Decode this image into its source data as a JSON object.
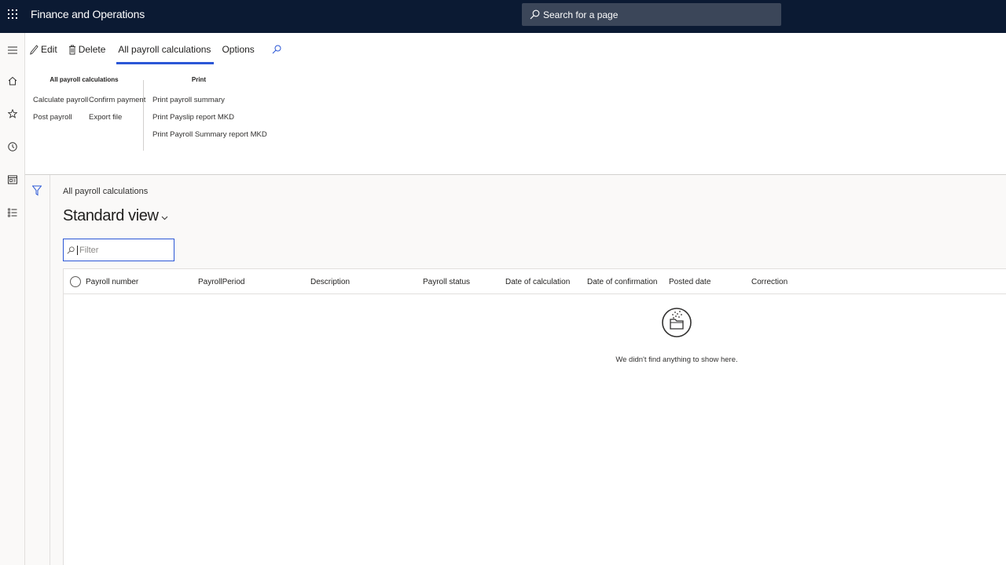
{
  "app": {
    "title": "Finance and Operations"
  },
  "search": {
    "placeholder": "Search for a page"
  },
  "nav": {
    "icons": [
      "hamburger-icon",
      "home-icon",
      "star-icon",
      "clock-icon",
      "workspace-icon",
      "list-icon"
    ]
  },
  "action_pane": {
    "edit_label": "Edit",
    "delete_label": "Delete",
    "tab_label": "All payroll calculations",
    "options_label": "Options",
    "groups": {
      "main": {
        "title": "All payroll calculations",
        "calculate": "Calculate payroll",
        "post": "Post payroll",
        "confirm": "Confirm payment",
        "export": "Export file"
      },
      "print": {
        "title": "Print",
        "summary": "Print payroll summary",
        "payslip": "Print Payslip report MKD",
        "summary_mkd": "Print Payroll Summary report MKD"
      }
    }
  },
  "page": {
    "caption": "All payroll calculations",
    "view_name": "Standard view",
    "filter_placeholder": "Filter"
  },
  "grid": {
    "columns": [
      "Payroll number",
      "PayrollPeriod",
      "Description",
      "Payroll status",
      "Date of calculation",
      "Date of confirmation",
      "Posted date",
      "Correction"
    ],
    "empty_message": "We didn't find anything to show here."
  },
  "colors": {
    "topbar": "#0b1a33",
    "accent": "#2b57d6"
  }
}
